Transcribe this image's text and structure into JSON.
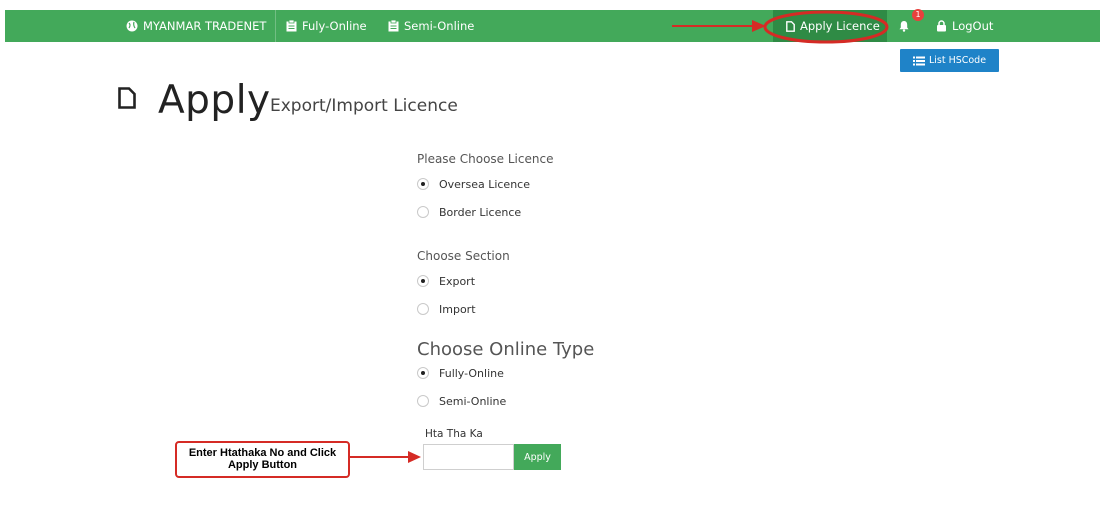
{
  "nav": {
    "brand": "MYANMAR TRADENET",
    "fully_online": "Fuly-Online",
    "semi_online": "Semi-Online",
    "apply_licence": "Apply Licence",
    "notification_count": "1",
    "logout": "LogOut"
  },
  "toolbar": {
    "list_hscode": "List HSCode"
  },
  "page": {
    "title": "Apply",
    "subtitle": "Export/Import Licence"
  },
  "form": {
    "licence": {
      "label": "Please Choose Licence",
      "options": [
        {
          "label": "Oversea Licence",
          "checked": true
        },
        {
          "label": "Border Licence",
          "checked": false
        }
      ]
    },
    "section": {
      "label": "Choose Section",
      "options": [
        {
          "label": "Export",
          "checked": true
        },
        {
          "label": "Import",
          "checked": false
        }
      ]
    },
    "online_type": {
      "label": "Choose Online Type",
      "options": [
        {
          "label": "Fully-Online",
          "checked": true
        },
        {
          "label": "Semi-Online",
          "checked": false
        }
      ]
    },
    "hta_label": "Hta Tha Ka",
    "hta_value": "",
    "apply_label": "Apply"
  },
  "annotation": {
    "line1": "Enter Htathaka No and Click",
    "line2": "Apply Button",
    "color": "#d52b25"
  },
  "colors": {
    "navbar": "#43a95a",
    "nav_active": "#2f8b45",
    "hscode_button": "#1f83c8",
    "badge": "#e8413d"
  }
}
